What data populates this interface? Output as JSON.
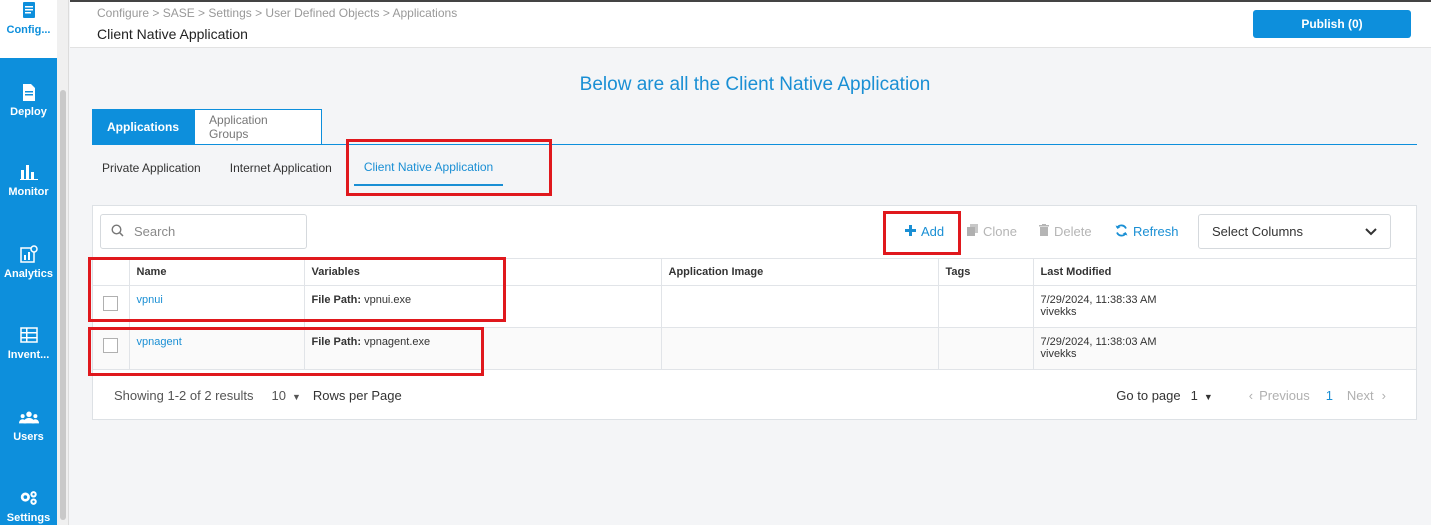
{
  "nav": {
    "items": [
      {
        "label": "Config...",
        "icon": "document-icon"
      },
      {
        "label": "Deploy",
        "icon": "deploy-icon"
      },
      {
        "label": "Monitor",
        "icon": "bar-chart-icon"
      },
      {
        "label": "Analytics",
        "icon": "analytics-icon"
      },
      {
        "label": "Invent...",
        "icon": "inventory-icon"
      },
      {
        "label": "Users",
        "icon": "users-icon"
      },
      {
        "label": "Settings",
        "icon": "gears-icon"
      }
    ]
  },
  "header": {
    "breadcrumb": "Configure > SASE > Settings > User Defined Objects > Applications",
    "title": "Client Native Application",
    "publish_label": "Publish (0)"
  },
  "main": {
    "title": "Below are all the Client Native Application",
    "tabs": [
      {
        "label": "Applications",
        "active": true
      },
      {
        "label": "Application Groups",
        "active": false
      }
    ],
    "sub_tabs": [
      {
        "label": "Private Application",
        "active": false
      },
      {
        "label": "Internet Application",
        "active": false
      },
      {
        "label": "Client Native Application",
        "active": true
      }
    ]
  },
  "toolbar": {
    "search_placeholder": "Search",
    "add_label": "Add",
    "clone_label": "Clone",
    "delete_label": "Delete",
    "refresh_label": "Refresh",
    "select_columns_label": "Select Columns"
  },
  "table": {
    "columns": [
      "Name",
      "Variables",
      "Application Image",
      "Tags",
      "Last Modified"
    ],
    "rows": [
      {
        "name": "vpnui",
        "var_key": "File Path:",
        "var_value": "vpnui.exe",
        "image": "",
        "tags": "",
        "modified_date": "7/29/2024, 11:38:33 AM",
        "modified_by": "vivekks"
      },
      {
        "name": "vpnagent",
        "var_key": "File Path:",
        "var_value": "vpnagent.exe",
        "image": "",
        "tags": "",
        "modified_date": "7/29/2024, 11:38:03 AM",
        "modified_by": "vivekks"
      }
    ]
  },
  "pager": {
    "showing": "Showing 1-2 of 2 results",
    "rows_per_page_value": "10",
    "rows_per_page_label": "Rows per Page",
    "goto_label": "Go to page",
    "goto_value": "1",
    "previous_label": "Previous",
    "current_page": "1",
    "next_label": "Next"
  },
  "colors": {
    "accent": "#0d8fdc",
    "highlight": "#e0181d"
  }
}
